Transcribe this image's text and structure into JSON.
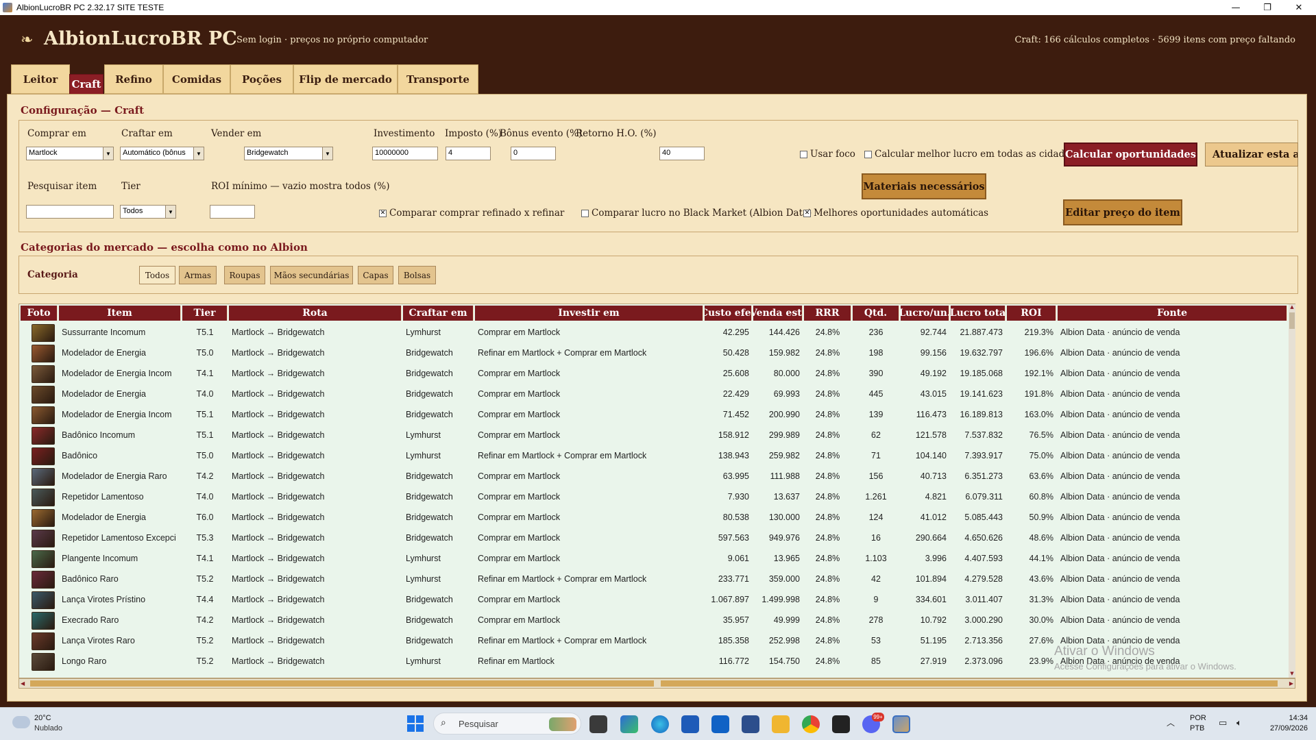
{
  "window": {
    "title": "AlbionLucroBR PC 2.32.17 SITE TESTE",
    "minimize": "—",
    "restore": "❐",
    "close": "✕"
  },
  "header": {
    "logo_glyph": "❧",
    "app_name": "AlbionLucroBR PC",
    "subtitle": "Sem login · preços no próprio computador",
    "status": "Craft: 166 cálculos completos · 5699 itens com preço faltando"
  },
  "tabs": [
    "Leitor",
    "Craft",
    "Refino",
    "Comidas",
    "Poções",
    "Flip de mercado",
    "Transporte"
  ],
  "active_tab": "Craft",
  "config": {
    "title": "Configuração — Craft",
    "comprar_em_label": "Comprar em",
    "comprar_em_value": "Martlock",
    "craftar_em_label": "Craftar em",
    "craftar_em_value": "Automático (bônus",
    "vender_em_label": "Vender em",
    "vender_em_value": "Bridgewatch",
    "investimento_label": "Investimento",
    "investimento_value": "10000000",
    "imposto_label": "Imposto (%)",
    "imposto_value": "4",
    "bonus_label": "Bônus evento (%)",
    "bonus_value": "0",
    "retorno_label": "Retorno H.O. (%)",
    "retorno_value": "40",
    "usar_foco_label": "Usar foco",
    "melhor_lucro_label": "Calcular melhor lucro em todas as cidades",
    "calcular_btn": "Calcular oportunidades",
    "atualizar_btn": "Atualizar esta aba",
    "materiais_btn": "Materiais necessários",
    "editar_btn": "Editar preço do item",
    "pesquisar_label": "Pesquisar item",
    "pesquisar_value": "",
    "tier_label": "Tier",
    "tier_value": "Todos",
    "roi_label": "ROI mínimo — vazio mostra todos (%)",
    "roi_value": "",
    "comparar_refinado_label": "Comparar comprar refinado x refinar",
    "comparar_refinado_checked": true,
    "comparar_bm_label": "Comparar lucro no Black Market (Albion Data)",
    "comparar_bm_checked": false,
    "melhores_auto_label": "Melhores oportunidades automáticas",
    "melhores_auto_checked": true
  },
  "categories": {
    "title": "Categorias do mercado — escolha como no Albion",
    "label": "Categoria",
    "items": [
      "Todos",
      "Armas",
      "Roupas",
      "Mãos secundárias",
      "Capas",
      "Bolsas"
    ],
    "active": "Todos"
  },
  "table": {
    "columns": [
      "Foto",
      "Item",
      "Tier",
      "Rota",
      "Craftar em",
      "Investir em",
      "Custo efet",
      "Venda esti",
      "RRR",
      "Qtd.",
      "Lucro/un.",
      "Lucro tota",
      "ROI",
      "Fonte"
    ],
    "rows": [
      {
        "item": "Sussurrante Incomum",
        "tier": "T5.1",
        "rota": "Martlock → Bridgewatch",
        "craftar": "Lymhurst",
        "investir": "Comprar em Martlock",
        "custo": "42.295",
        "venda": "144.426",
        "rrr": "24.8%",
        "qtd": "236",
        "lucro_un": "92.744",
        "lucro_tot": "21.887.473",
        "roi": "219.3%",
        "fonte": "Albion Data · anúncio de venda",
        "img": "#8a6a2a"
      },
      {
        "item": "Modelador de Energia",
        "tier": "T5.0",
        "rota": "Martlock → Bridgewatch",
        "craftar": "Bridgewatch",
        "investir": "Refinar em Martlock + Comprar em Martlock",
        "custo": "50.428",
        "venda": "159.982",
        "rrr": "24.8%",
        "qtd": "198",
        "lucro_un": "99.156",
        "lucro_tot": "19.632.797",
        "roi": "196.6%",
        "fonte": "Albion Data · anúncio de venda",
        "img": "#9a5a30"
      },
      {
        "item": "Modelador de Energia Incom",
        "tier": "T4.1",
        "rota": "Martlock → Bridgewatch",
        "craftar": "Bridgewatch",
        "investir": "Comprar em Martlock",
        "custo": "25.608",
        "venda": "80.000",
        "rrr": "24.8%",
        "qtd": "390",
        "lucro_un": "49.192",
        "lucro_tot": "19.185.068",
        "roi": "192.1%",
        "fonte": "Albion Data · anúncio de venda",
        "img": "#7a5a3a"
      },
      {
        "item": "Modelador de Energia",
        "tier": "T4.0",
        "rota": "Martlock → Bridgewatch",
        "craftar": "Bridgewatch",
        "investir": "Comprar em Martlock",
        "custo": "22.429",
        "venda": "69.993",
        "rrr": "24.8%",
        "qtd": "445",
        "lucro_un": "43.015",
        "lucro_tot": "19.141.623",
        "roi": "191.8%",
        "fonte": "Albion Data · anúncio de venda",
        "img": "#6a4a2a"
      },
      {
        "item": "Modelador de Energia Incom",
        "tier": "T5.1",
        "rota": "Martlock → Bridgewatch",
        "craftar": "Bridgewatch",
        "investir": "Comprar em Martlock",
        "custo": "71.452",
        "venda": "200.990",
        "rrr": "24.8%",
        "qtd": "139",
        "lucro_un": "116.473",
        "lucro_tot": "16.189.813",
        "roi": "163.0%",
        "fonte": "Albion Data · anúncio de venda",
        "img": "#8a5a30"
      },
      {
        "item": "Badônico Incomum",
        "tier": "T5.1",
        "rota": "Martlock → Bridgewatch",
        "craftar": "Lymhurst",
        "investir": "Comprar em Martlock",
        "custo": "158.912",
        "venda": "299.989",
        "rrr": "24.8%",
        "qtd": "62",
        "lucro_un": "121.578",
        "lucro_tot": "7.537.832",
        "roi": "76.5%",
        "fonte": "Albion Data · anúncio de venda",
        "img": "#8a2a2a"
      },
      {
        "item": "Badônico",
        "tier": "T5.0",
        "rota": "Martlock → Bridgewatch",
        "craftar": "Lymhurst",
        "investir": "Refinar em Martlock + Comprar em Martlock",
        "custo": "138.943",
        "venda": "259.982",
        "rrr": "24.8%",
        "qtd": "71",
        "lucro_un": "104.140",
        "lucro_tot": "7.393.917",
        "roi": "75.0%",
        "fonte": "Albion Data · anúncio de venda",
        "img": "#7a2020"
      },
      {
        "item": "Modelador de Energia Raro",
        "tier": "T4.2",
        "rota": "Martlock → Bridgewatch",
        "craftar": "Bridgewatch",
        "investir": "Comprar em Martlock",
        "custo": "63.995",
        "venda": "111.988",
        "rrr": "24.8%",
        "qtd": "156",
        "lucro_un": "40.713",
        "lucro_tot": "6.351.273",
        "roi": "63.6%",
        "fonte": "Albion Data · anúncio de venda",
        "img": "#5a6a7a"
      },
      {
        "item": "Repetidor Lamentoso",
        "tier": "T4.0",
        "rota": "Martlock → Bridgewatch",
        "craftar": "Bridgewatch",
        "investir": "Comprar em Martlock",
        "custo": "7.930",
        "venda": "13.637",
        "rrr": "24.8%",
        "qtd": "1.261",
        "lucro_un": "4.821",
        "lucro_tot": "6.079.311",
        "roi": "60.8%",
        "fonte": "Albion Data · anúncio de venda",
        "img": "#4a5a5a"
      },
      {
        "item": "Modelador de Energia",
        "tier": "T6.0",
        "rota": "Martlock → Bridgewatch",
        "craftar": "Bridgewatch",
        "investir": "Comprar em Martlock",
        "custo": "80.538",
        "venda": "130.000",
        "rrr": "24.8%",
        "qtd": "124",
        "lucro_un": "41.012",
        "lucro_tot": "5.085.443",
        "roi": "50.9%",
        "fonte": "Albion Data · anúncio de venda",
        "img": "#9a6a30"
      },
      {
        "item": "Repetidor Lamentoso Excepci",
        "tier": "T5.3",
        "rota": "Martlock → Bridgewatch",
        "craftar": "Bridgewatch",
        "investir": "Comprar em Martlock",
        "custo": "597.563",
        "venda": "949.976",
        "rrr": "24.8%",
        "qtd": "16",
        "lucro_un": "290.664",
        "lucro_tot": "4.650.626",
        "roi": "48.6%",
        "fonte": "Albion Data · anúncio de venda",
        "img": "#5a3a4a"
      },
      {
        "item": "Plangente Incomum",
        "tier": "T4.1",
        "rota": "Martlock → Bridgewatch",
        "craftar": "Lymhurst",
        "investir": "Comprar em Martlock",
        "custo": "9.061",
        "venda": "13.965",
        "rrr": "24.8%",
        "qtd": "1.103",
        "lucro_un": "3.996",
        "lucro_tot": "4.407.593",
        "roi": "44.1%",
        "fonte": "Albion Data · anúncio de venda",
        "img": "#4a6a4a"
      },
      {
        "item": "Badônico Raro",
        "tier": "T5.2",
        "rota": "Martlock → Bridgewatch",
        "craftar": "Lymhurst",
        "investir": "Refinar em Martlock + Comprar em Martlock",
        "custo": "233.771",
        "venda": "359.000",
        "rrr": "24.8%",
        "qtd": "42",
        "lucro_un": "101.894",
        "lucro_tot": "4.279.528",
        "roi": "43.6%",
        "fonte": "Albion Data · anúncio de venda",
        "img": "#6a2a3a"
      },
      {
        "item": "Lança Virotes Prístino",
        "tier": "T4.4",
        "rota": "Martlock → Bridgewatch",
        "craftar": "Bridgewatch",
        "investir": "Comprar em Martlock",
        "custo": "1.067.897",
        "venda": "1.499.998",
        "rrr": "24.8%",
        "qtd": "9",
        "lucro_un": "334.601",
        "lucro_tot": "3.011.407",
        "roi": "31.3%",
        "fonte": "Albion Data · anúncio de venda",
        "img": "#3a5a6a"
      },
      {
        "item": "Execrado Raro",
        "tier": "T4.2",
        "rota": "Martlock → Bridgewatch",
        "craftar": "Bridgewatch",
        "investir": "Comprar em Martlock",
        "custo": "35.957",
        "venda": "49.999",
        "rrr": "24.8%",
        "qtd": "278",
        "lucro_un": "10.792",
        "lucro_tot": "3.000.290",
        "roi": "30.0%",
        "fonte": "Albion Data · anúncio de venda",
        "img": "#2a6a6a"
      },
      {
        "item": "Lança Virotes Raro",
        "tier": "T5.2",
        "rota": "Martlock → Bridgewatch",
        "craftar": "Bridgewatch",
        "investir": "Refinar em Martlock + Comprar em Martlock",
        "custo": "185.358",
        "venda": "252.998",
        "rrr": "24.8%",
        "qtd": "53",
        "lucro_un": "51.195",
        "lucro_tot": "2.713.356",
        "roi": "27.6%",
        "fonte": "Albion Data · anúncio de venda",
        "img": "#6a3a2a"
      },
      {
        "item": "Longo Raro",
        "tier": "T5.2",
        "rota": "Martlock → Bridgewatch",
        "craftar": "Lymhurst",
        "investir": "Refinar em Martlock",
        "custo": "116.772",
        "venda": "154.750",
        "rrr": "24.8%",
        "qtd": "85",
        "lucro_un": "27.919",
        "lucro_tot": "2.373.096",
        "roi": "23.9%",
        "fonte": "Albion Data · anúncio de venda",
        "img": "#5a4a3a"
      }
    ]
  },
  "watermark": {
    "line1": "Ativar o Windows",
    "line2": "Acesse Configurações para ativar o Windows."
  },
  "taskbar": {
    "weather_temp": "20°C",
    "weather_desc": "Nublado",
    "search_placeholder": "Pesquisar",
    "lang1": "POR",
    "lang2": "PTB",
    "time": "14:34",
    "date": "27/09/2026",
    "notification_badge": "99+"
  }
}
